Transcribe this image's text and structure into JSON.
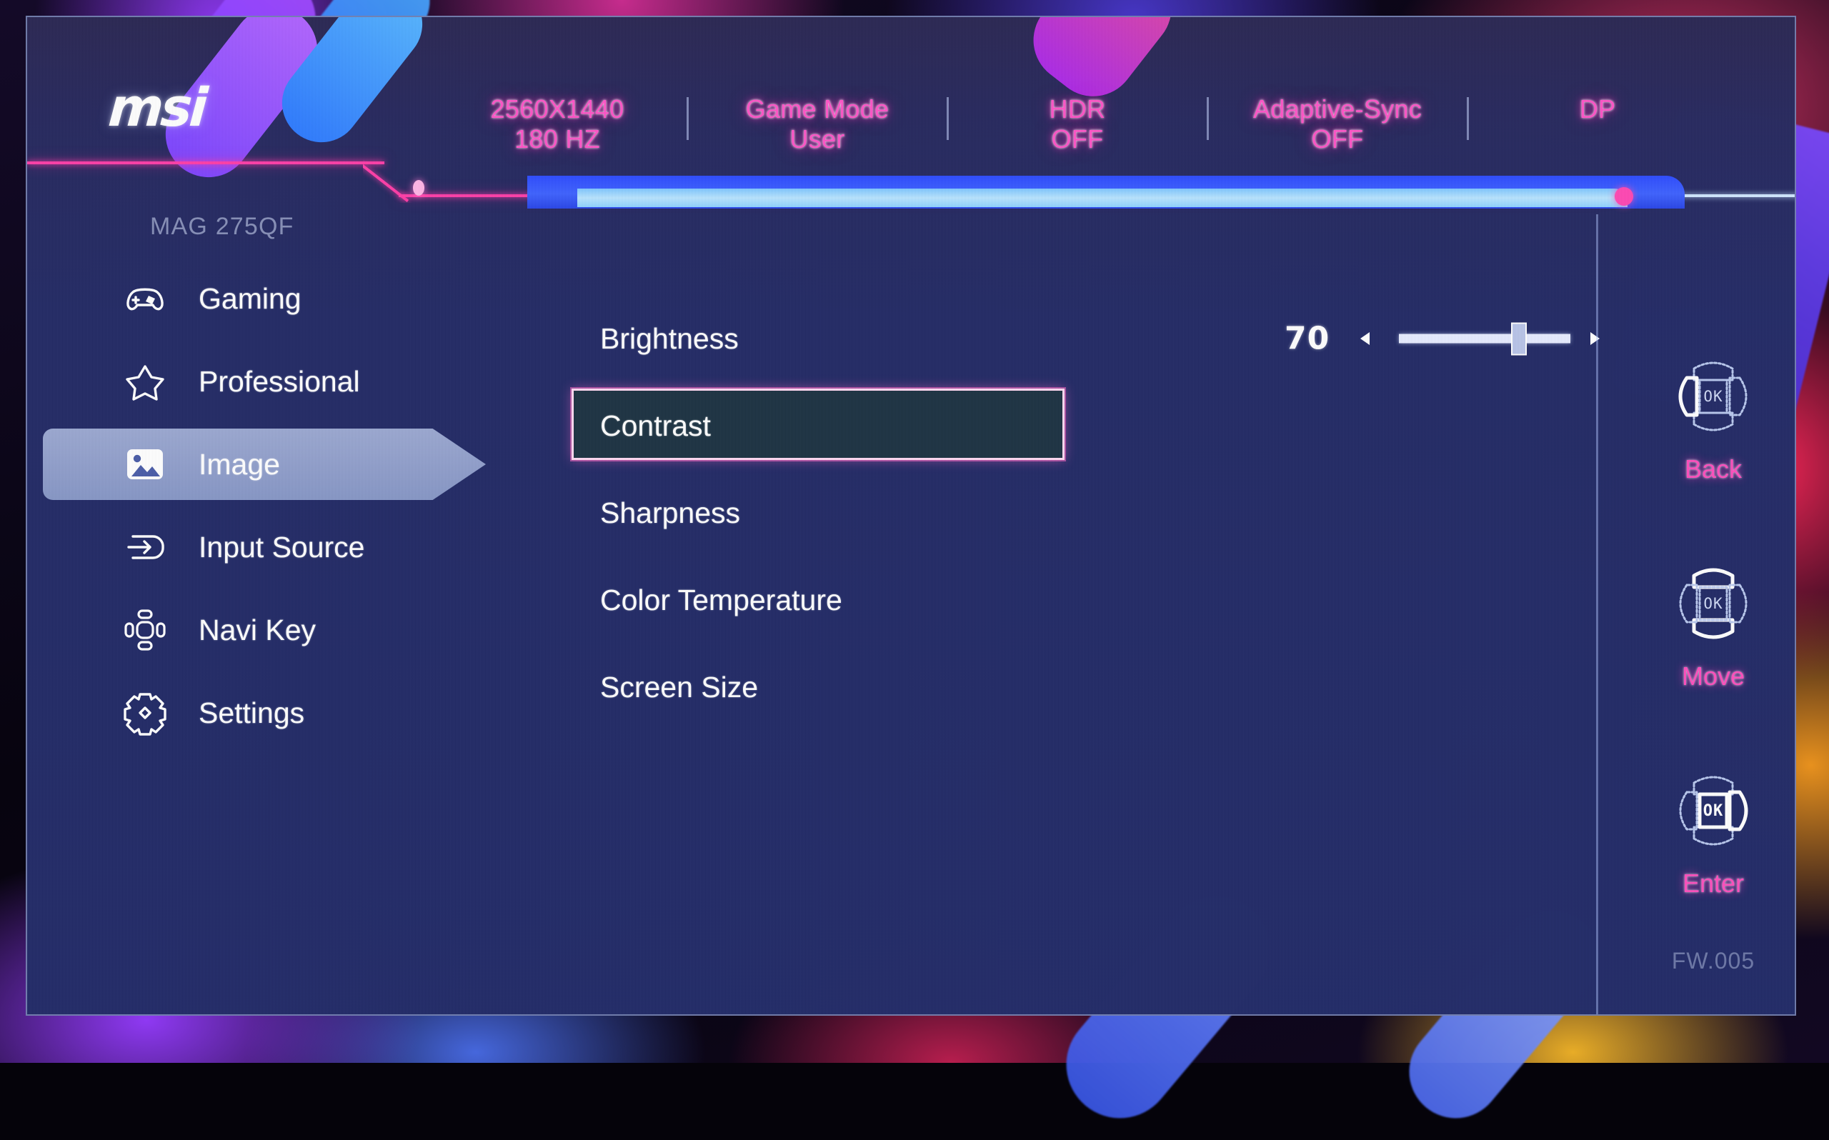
{
  "brand": {
    "logo_text": "msi",
    "model": "MAG 275QF",
    "firmware": "FW.005"
  },
  "status_bar": [
    {
      "label": "2560X1440",
      "value": "180 HZ",
      "name": "resolution"
    },
    {
      "label": "Game Mode",
      "value": "User",
      "name": "game-mode"
    },
    {
      "label": "HDR",
      "value": "OFF",
      "name": "hdr"
    },
    {
      "label": "Adaptive-Sync",
      "value": "OFF",
      "name": "adaptive-sync"
    },
    {
      "label": "DP",
      "value": "",
      "name": "input-source"
    }
  ],
  "sidebar": {
    "items": [
      {
        "label": "Gaming",
        "icon": "gamepad-icon",
        "active": false
      },
      {
        "label": "Professional",
        "icon": "star-icon",
        "active": false
      },
      {
        "label": "Image",
        "icon": "picture-icon",
        "active": true
      },
      {
        "label": "Input Source",
        "icon": "input-arrow-icon",
        "active": false
      },
      {
        "label": "Navi Key",
        "icon": "navi-key-icon",
        "active": false
      },
      {
        "label": "Settings",
        "icon": "gear-icon",
        "active": false
      }
    ]
  },
  "content": {
    "rows": [
      {
        "label": "Brightness",
        "selected": false,
        "has_slider": true
      },
      {
        "label": "Contrast",
        "selected": true,
        "has_slider": false
      },
      {
        "label": "Sharpness",
        "selected": false,
        "has_slider": false
      },
      {
        "label": "Color Temperature",
        "selected": false,
        "has_slider": false
      },
      {
        "label": "Screen Size",
        "selected": false,
        "has_slider": false
      }
    ],
    "slider": {
      "value": "70",
      "percent": 70,
      "min": 0,
      "max": 100
    }
  },
  "nav_hints": [
    {
      "label": "Back",
      "icon": "joystick-left-icon"
    },
    {
      "label": "Move",
      "icon": "joystick-updown-icon"
    },
    {
      "label": "Enter",
      "icon": "joystick-right-icon"
    }
  ],
  "colors": {
    "accent_pink": "#ff4fbe",
    "panel_bg": "#242c6a",
    "selected_row_bg": "#1c363a",
    "selected_row_border": "#ffd9f2",
    "sidebar_highlight": "#bac8ec",
    "text_primary": "#ffffff",
    "text_dim": "#b9c6e6"
  }
}
